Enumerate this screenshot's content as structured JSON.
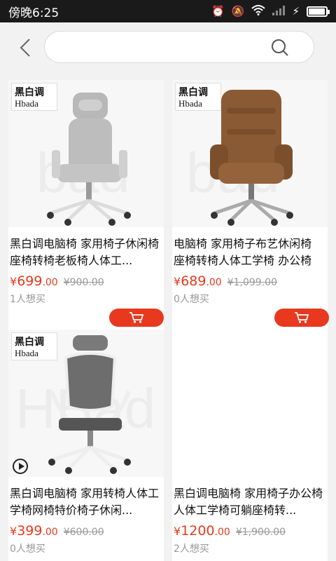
{
  "status": {
    "time": "傍晚6:25"
  },
  "search": {
    "placeholder": ""
  },
  "products": [
    {
      "brand_cn": "黑白调",
      "brand_en": "Hbada",
      "title": "黑白调电脑椅 家用椅子休闲椅 座椅转椅老板椅人体工...",
      "currency": "¥",
      "price_main": "699",
      "price_dec": ".00",
      "old_price": "¥900.00",
      "want": "1人想买",
      "color": "grey-headrest"
    },
    {
      "brand_cn": "黑白调",
      "brand_en": "Hbada",
      "title": "电脑椅 家用椅子布艺休闲椅 座椅转椅人体工学椅 办公椅",
      "currency": "¥",
      "price_main": "689",
      "price_dec": ".00",
      "old_price": "¥1,099.00",
      "want": "0人想买",
      "color": "brown"
    },
    {
      "brand_cn": "黑白调",
      "brand_en": "Hbada",
      "title": "黑白调电脑椅 家用转椅人体工学椅网椅特价椅子休闲...",
      "currency": "¥",
      "price_main": "399",
      "price_dec": ".00",
      "old_price": "¥600.00",
      "want": "0人想买",
      "color": "grey-mesh"
    },
    {
      "brand_cn": "",
      "brand_en": "",
      "title": "黑白调电脑椅 家用椅子办公椅人体工学椅可躺座椅转...",
      "currency": "¥",
      "price_main": "1200",
      "price_dec": ".00",
      "old_price": "¥1,900.00",
      "want": "2人想买",
      "color": "blank"
    }
  ],
  "colors": {
    "accent": "#e8391f"
  }
}
